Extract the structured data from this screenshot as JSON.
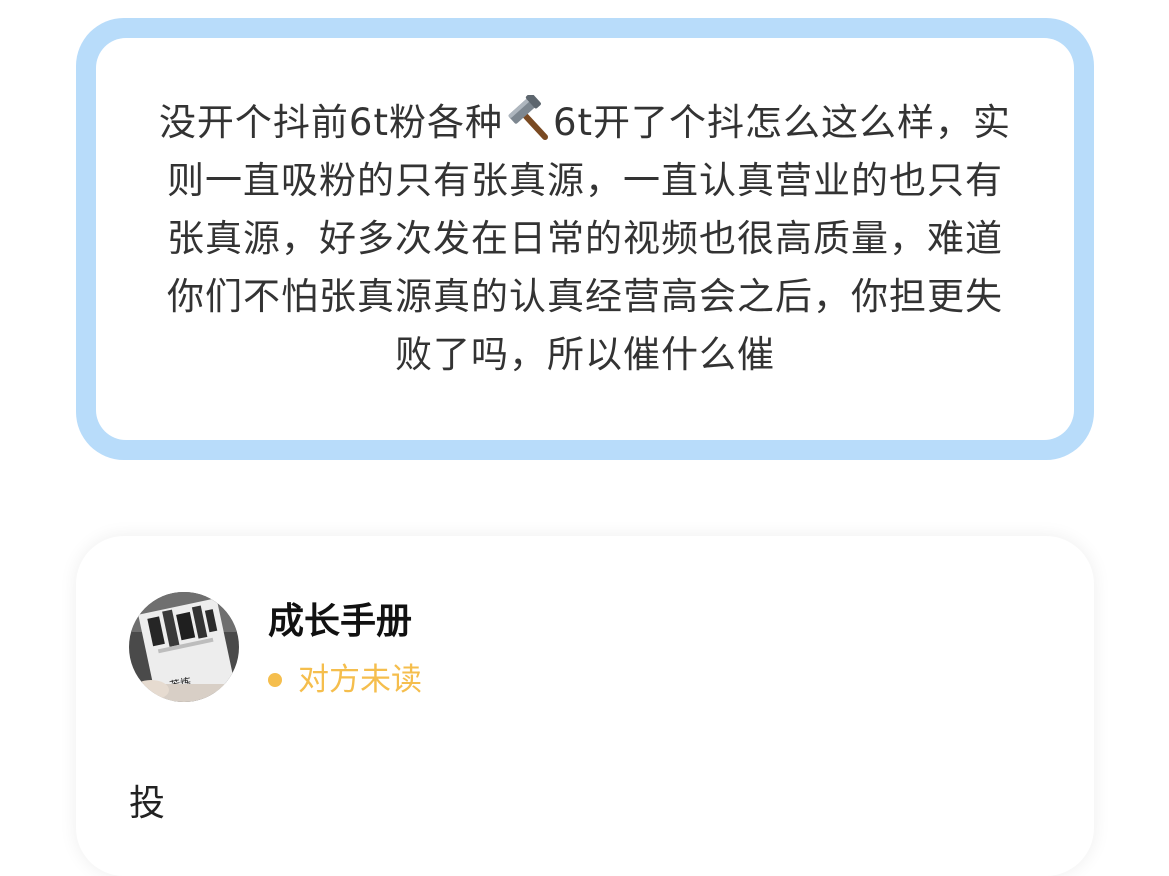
{
  "quote": {
    "text_before_icon": "没开个抖前6t粉各种",
    "icon": "hammer-icon",
    "text_after_icon": "6t开了个抖怎么这么样，实则一直吸粉的只有张真源，一直认真营业的也只有张真源，好多次发在日常的视频也很高质量，难道你们不怕张真源真的认真经营高会之后，你担更失败了吗，所以催什么催"
  },
  "reply": {
    "avatar_caption": "苦炼",
    "user_name": "成长手册",
    "status_label": "对方未读",
    "message": "投"
  },
  "colors": {
    "quote_border": "#b8dcfa",
    "status": "#f5be4d"
  }
}
